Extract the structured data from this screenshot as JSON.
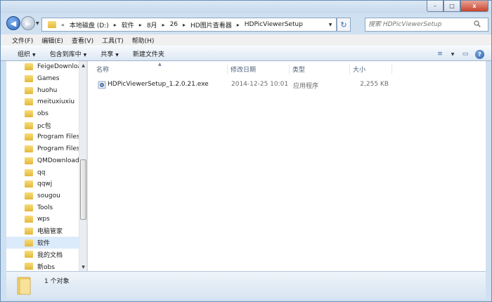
{
  "window": {
    "controls": [
      "–",
      "□",
      "x"
    ]
  },
  "navigation": {
    "back": "◀",
    "forward": "▶",
    "dropdown": "▼"
  },
  "address": {
    "prefix": "«",
    "crumbs": [
      "本地磁盘 (D:)",
      "软件",
      "8月",
      "26",
      "HD图片查看器",
      "HDPicViewerSetup"
    ],
    "separator": "▸",
    "dropdown": "▼",
    "refresh": "↻"
  },
  "search": {
    "placeholder": "搜索 HDPicViewerSetup",
    "icon": "search-icon"
  },
  "menu": [
    "文件(F)",
    "编辑(E)",
    "查看(V)",
    "工具(T)",
    "帮助(H)"
  ],
  "commands": {
    "organize": "组织",
    "include_library": "包含到库中",
    "share": "共享",
    "new_folder": "新建文件夹",
    "caret": "▼",
    "view_icon": "≡",
    "view_caret": "▼",
    "preview_icon": "▭",
    "help_label": "?"
  },
  "nav_pane": {
    "items": [
      {
        "label": "FeigeDownloa"
      },
      {
        "label": "Games"
      },
      {
        "label": "huohu"
      },
      {
        "label": "meituxiuxiu"
      },
      {
        "label": "obs"
      },
      {
        "label": "pc包"
      },
      {
        "label": "Program Files"
      },
      {
        "label": "Program Files"
      },
      {
        "label": "QMDownload"
      },
      {
        "label": "qq"
      },
      {
        "label": "qqwj"
      },
      {
        "label": "sougou"
      },
      {
        "label": "Tools"
      },
      {
        "label": "wps"
      },
      {
        "label": "电脑管家"
      },
      {
        "label": "软件",
        "selected": true
      },
      {
        "label": "我的文档"
      },
      {
        "label": "新obs"
      }
    ],
    "scroll_up": "▲",
    "scroll_down": "▼"
  },
  "columns": {
    "name": "名称",
    "modified": "修改日期",
    "type": "类型",
    "size": "大小",
    "sort_indicator": "▲"
  },
  "files": [
    {
      "name": "HDPicViewerSetup_1.2.0.21.exe",
      "modified": "2014-12-25 10:01",
      "type": "应用程序",
      "size": "2,255 KB"
    }
  ],
  "status": {
    "text": "1 个对象"
  },
  "colors": {
    "accent": "#2c66b8",
    "folder": "#e3b83c",
    "selection": "#dcebfc"
  }
}
